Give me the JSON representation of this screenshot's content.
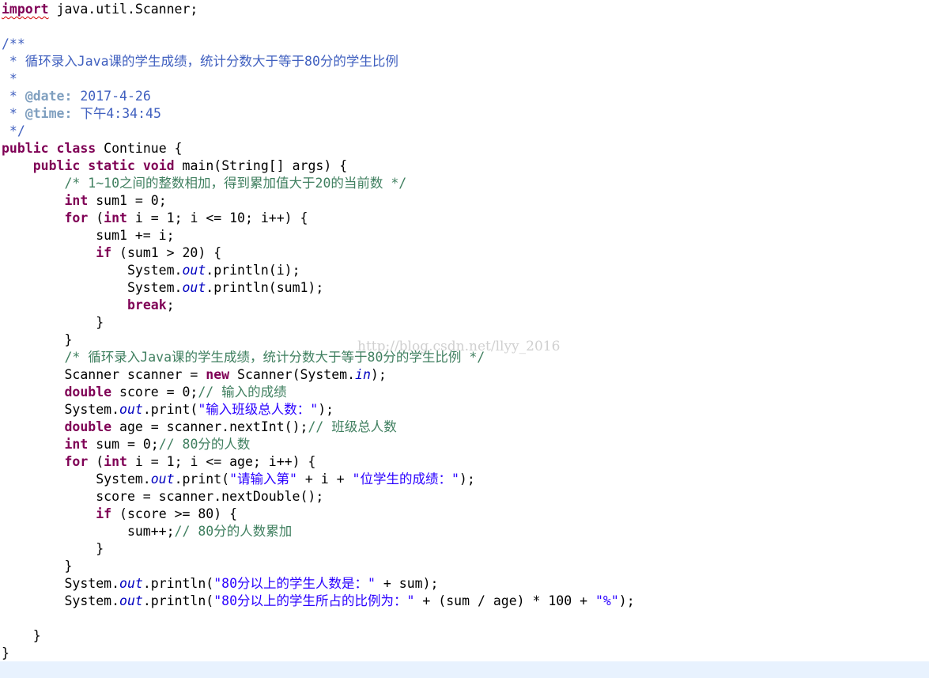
{
  "editor": {
    "lines": [
      [
        {
          "c": "kw err",
          "t": "import"
        },
        {
          "c": "",
          "t": " java.util.Scanner;"
        }
      ],
      [],
      [
        {
          "c": "jd",
          "t": "/**"
        }
      ],
      [
        {
          "c": "jd",
          "t": " * 循环录入Java课的学生成绩，统计分数大于等于80分的学生比例"
        }
      ],
      [
        {
          "c": "jd",
          "t": " *"
        }
      ],
      [
        {
          "c": "jd",
          "t": " * "
        },
        {
          "c": "tag",
          "t": "@date:"
        },
        {
          "c": "jd",
          "t": " 2017-4-26"
        }
      ],
      [
        {
          "c": "jd",
          "t": " * "
        },
        {
          "c": "tag",
          "t": "@time:"
        },
        {
          "c": "jd",
          "t": " 下午4:34:45"
        }
      ],
      [
        {
          "c": "jd",
          "t": " */"
        }
      ],
      [
        {
          "c": "kw",
          "t": "public"
        },
        {
          "c": "",
          "t": " "
        },
        {
          "c": "kw",
          "t": "class"
        },
        {
          "c": "",
          "t": " Continue {"
        }
      ],
      [
        {
          "c": "",
          "t": "    "
        },
        {
          "c": "kw",
          "t": "public"
        },
        {
          "c": "",
          "t": " "
        },
        {
          "c": "kw",
          "t": "static"
        },
        {
          "c": "",
          "t": " "
        },
        {
          "c": "kw",
          "t": "void"
        },
        {
          "c": "",
          "t": " main(String[] args) {"
        }
      ],
      [
        {
          "c": "",
          "t": "        "
        },
        {
          "c": "cm",
          "t": "/* 1~10之间的整数相加，得到累加值大于20的当前数 */"
        }
      ],
      [
        {
          "c": "",
          "t": "        "
        },
        {
          "c": "kw",
          "t": "int"
        },
        {
          "c": "",
          "t": " sum1 = 0;"
        }
      ],
      [
        {
          "c": "",
          "t": "        "
        },
        {
          "c": "kw",
          "t": "for"
        },
        {
          "c": "",
          "t": " ("
        },
        {
          "c": "kw",
          "t": "int"
        },
        {
          "c": "",
          "t": " i = 1; i <= 10; i++) {"
        }
      ],
      [
        {
          "c": "",
          "t": "            sum1 += i;"
        }
      ],
      [
        {
          "c": "",
          "t": "            "
        },
        {
          "c": "kw",
          "t": "if"
        },
        {
          "c": "",
          "t": " (sum1 > 20) {"
        }
      ],
      [
        {
          "c": "",
          "t": "                System."
        },
        {
          "c": "fld",
          "t": "out"
        },
        {
          "c": "",
          "t": ".println(i);"
        }
      ],
      [
        {
          "c": "",
          "t": "                System."
        },
        {
          "c": "fld",
          "t": "out"
        },
        {
          "c": "",
          "t": ".println(sum1);"
        }
      ],
      [
        {
          "c": "",
          "t": "                "
        },
        {
          "c": "kw",
          "t": "break"
        },
        {
          "c": "",
          "t": ";"
        }
      ],
      [
        {
          "c": "",
          "t": "            }"
        }
      ],
      [
        {
          "c": "",
          "t": "        }"
        }
      ],
      [
        {
          "c": "",
          "t": "        "
        },
        {
          "c": "cm",
          "t": "/* 循环录入Java课的学生成绩，统计分数大于等于80分的学生比例 */"
        }
      ],
      [
        {
          "c": "",
          "t": "        Scanner scanner = "
        },
        {
          "c": "kw",
          "t": "new"
        },
        {
          "c": "",
          "t": " Scanner(System."
        },
        {
          "c": "fld",
          "t": "in"
        },
        {
          "c": "",
          "t": ");"
        }
      ],
      [
        {
          "c": "",
          "t": "        "
        },
        {
          "c": "kw",
          "t": "double"
        },
        {
          "c": "",
          "t": " score = 0;"
        },
        {
          "c": "cm",
          "t": "// 输入的成绩"
        }
      ],
      [
        {
          "c": "",
          "t": "        System."
        },
        {
          "c": "fld",
          "t": "out"
        },
        {
          "c": "",
          "t": ".print("
        },
        {
          "c": "str",
          "t": "\"输入班级总人数：\""
        },
        {
          "c": "",
          "t": ");"
        }
      ],
      [
        {
          "c": "",
          "t": "        "
        },
        {
          "c": "kw",
          "t": "double"
        },
        {
          "c": "",
          "t": " age = scanner.nextInt();"
        },
        {
          "c": "cm",
          "t": "// 班级总人数"
        }
      ],
      [
        {
          "c": "",
          "t": "        "
        },
        {
          "c": "kw",
          "t": "int"
        },
        {
          "c": "",
          "t": " sum = 0;"
        },
        {
          "c": "cm",
          "t": "// 80分的人数"
        }
      ],
      [
        {
          "c": "",
          "t": "        "
        },
        {
          "c": "kw",
          "t": "for"
        },
        {
          "c": "",
          "t": " ("
        },
        {
          "c": "kw",
          "t": "int"
        },
        {
          "c": "",
          "t": " i = 1; i <= age; i++) {"
        }
      ],
      [
        {
          "c": "",
          "t": "            System."
        },
        {
          "c": "fld",
          "t": "out"
        },
        {
          "c": "",
          "t": ".print("
        },
        {
          "c": "str",
          "t": "\"请输入第\""
        },
        {
          "c": "",
          "t": " + i + "
        },
        {
          "c": "str",
          "t": "\"位学生的成绩：\""
        },
        {
          "c": "",
          "t": ");"
        }
      ],
      [
        {
          "c": "",
          "t": "            score = scanner.nextDouble();"
        }
      ],
      [
        {
          "c": "",
          "t": "            "
        },
        {
          "c": "kw",
          "t": "if"
        },
        {
          "c": "",
          "t": " (score >= 80) {"
        }
      ],
      [
        {
          "c": "",
          "t": "                sum++;"
        },
        {
          "c": "cm",
          "t": "// 80分的人数累加"
        }
      ],
      [
        {
          "c": "",
          "t": "            }"
        }
      ],
      [
        {
          "c": "",
          "t": "        }"
        }
      ],
      [
        {
          "c": "",
          "t": "        System."
        },
        {
          "c": "fld",
          "t": "out"
        },
        {
          "c": "",
          "t": ".println("
        },
        {
          "c": "str",
          "t": "\"80分以上的学生人数是：\""
        },
        {
          "c": "",
          "t": " + sum);"
        }
      ],
      [
        {
          "c": "",
          "t": "        System."
        },
        {
          "c": "fld",
          "t": "out"
        },
        {
          "c": "",
          "t": ".println("
        },
        {
          "c": "str",
          "t": "\"80分以上的学生所占的比例为：\""
        },
        {
          "c": "",
          "t": " + (sum / age) * 100 + "
        },
        {
          "c": "str",
          "t": "\"%\""
        },
        {
          "c": "",
          "t": ");"
        }
      ],
      [],
      [
        {
          "c": "",
          "t": "    }"
        }
      ],
      [
        {
          "c": "",
          "t": "}"
        }
      ]
    ]
  },
  "watermark": "http://blog.csdn.net/llyy_2016",
  "colors": {
    "keyword": "#7f0055",
    "comment": "#3f7f5f",
    "javadoc": "#3f5fbf",
    "javadoc_tag": "#7f9fbf",
    "string": "#2a00ff",
    "static_field": "#0000c0",
    "current_line": "#e8f2fe"
  }
}
